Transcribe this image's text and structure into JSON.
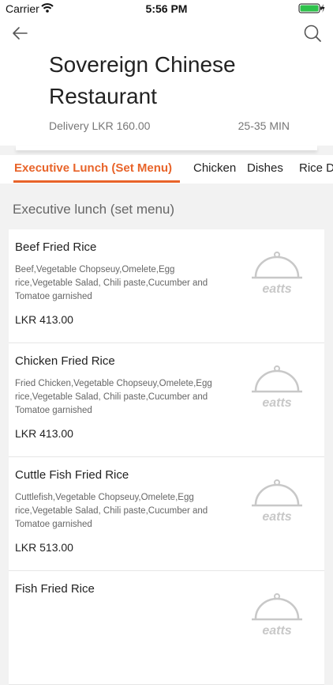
{
  "status_bar": {
    "carrier": "Carrier",
    "time": "5:56 PM"
  },
  "restaurant": {
    "name": "Sovereign Chinese Restaurant",
    "delivery": "Delivery LKR 160.00",
    "eta": "25-35 MIN"
  },
  "tabs": [
    {
      "label": "Executive Lunch (Set Menu)",
      "active": true
    },
    {
      "label": "Chicken"
    },
    {
      "label": "Dishes"
    },
    {
      "label": "Rice D"
    }
  ],
  "section": {
    "title": "Executive lunch (set menu)"
  },
  "items": [
    {
      "name": "Beef Fried Rice",
      "description": "Beef,Vegetable Chopseuy,Omelete,Egg rice,Vegetable Salad, Chili paste,Cucumber and Tomatoe garnished",
      "price": "LKR 413.00",
      "image_text": "eatts"
    },
    {
      "name": "Chicken Fried Rice",
      "description": "Fried Chicken,Vegetable Chopseuy,Omelete,Egg rice,Vegetable Salad, Chili paste,Cucumber and Tomatoe garnished",
      "price": "LKR 413.00",
      "image_text": "eatts"
    },
    {
      "name": "Cuttle Fish Fried Rice",
      "description": "Cuttlefish,Vegetable Chopseuy,Omelete,Egg rice,Vegetable Salad, Chili paste,Cucumber and Tomatoe garnished",
      "price": "LKR 513.00",
      "image_text": "eatts"
    },
    {
      "name": "Fish Fried Rice",
      "description": "",
      "price": "",
      "image_text": "eatts"
    }
  ],
  "colors": {
    "accent": "#e8642a",
    "placeholder_gray": "#c8c8c8"
  },
  "icons": [
    "wifi-icon",
    "battery-icon",
    "back-arrow-icon",
    "search-icon",
    "cloche-icon"
  ]
}
